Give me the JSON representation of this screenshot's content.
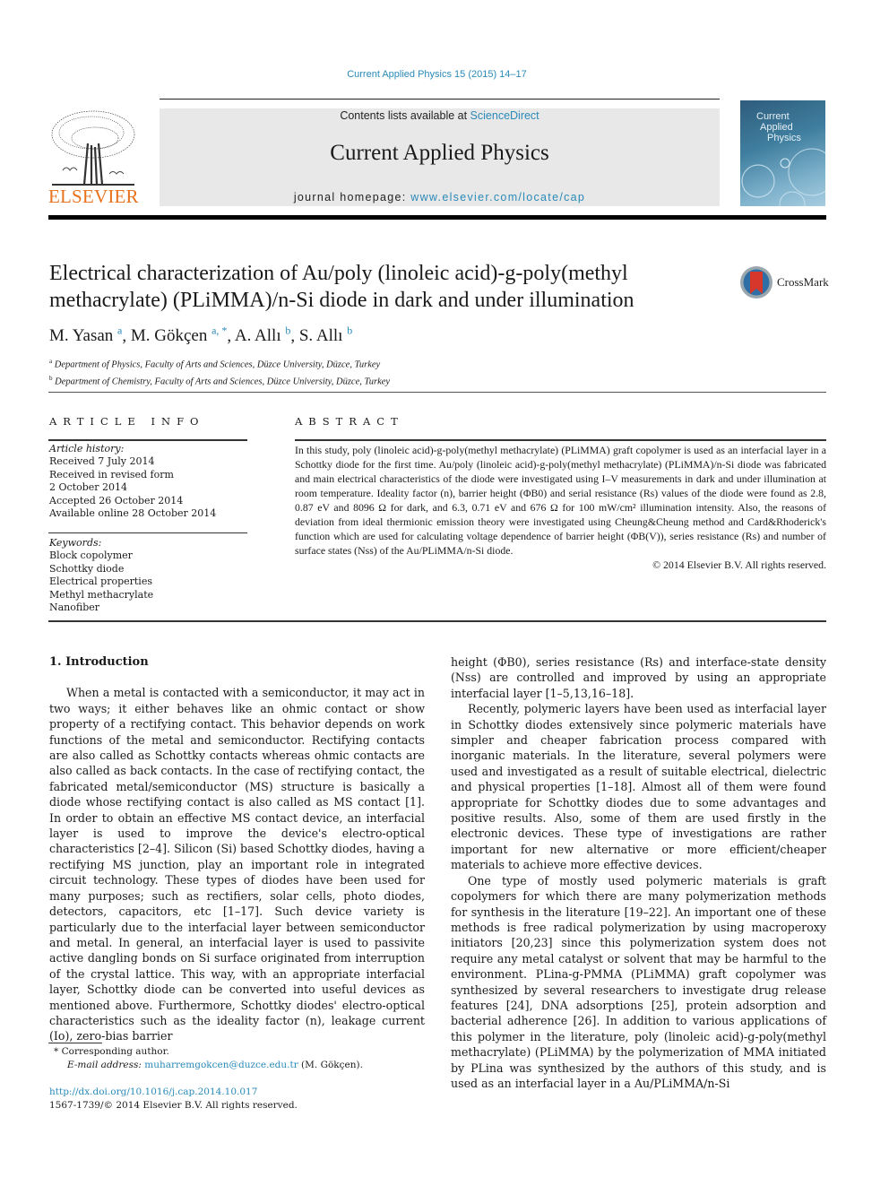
{
  "journal_reference": "Current Applied Physics 15 (2015) 14–17",
  "header": {
    "publisher_logo_text": "ELSEVIER",
    "contents_prefix": "Contents lists available at ",
    "contents_link": "ScienceDirect",
    "journal_name": "Current Applied Physics",
    "homepage_prefix": "journal homepage: ",
    "homepage_link": "www.elsevier.com/locate/cap",
    "cover_title_lines": [
      "Current",
      "Applied",
      "Physics"
    ]
  },
  "crossmark_label": "CrossMark",
  "article": {
    "title": "Electrical characterization of Au/poly (linoleic acid)-g-poly(methyl methacrylate) (PLiMMA)/n-Si diode in dark and under illumination",
    "authors": [
      {
        "name": "M. Yasan",
        "sup": "a"
      },
      {
        "name": "M. Gökçen",
        "sup": "a, *"
      },
      {
        "name": "A. Allı",
        "sup": "b"
      },
      {
        "name": "S. Allı",
        "sup": "b"
      }
    ],
    "affiliations": [
      {
        "mark": "a",
        "text": "Department of Physics, Faculty of Arts and Sciences, Düzce University, Düzce, Turkey"
      },
      {
        "mark": "b",
        "text": "Department of Chemistry, Faculty of Arts and Sciences, Düzce University, Düzce, Turkey"
      }
    ]
  },
  "article_info": {
    "heading": "ARTICLE INFO",
    "history_label": "Article history:",
    "history": [
      "Received 7 July 2014",
      "Received in revised form",
      "2 October 2014",
      "Accepted 26 October 2014",
      "Available online 28 October 2014"
    ],
    "keywords_label": "Keywords:",
    "keywords": [
      "Block copolymer",
      "Schottky diode",
      "Electrical properties",
      "Methyl methacrylate",
      "Nanofiber"
    ]
  },
  "abstract": {
    "heading": "ABSTRACT",
    "text": "In this study, poly (linoleic acid)-g-poly(methyl methacrylate) (PLiMMA) graft copolymer is used as an interfacial layer in a Schottky diode for the first time. Au/poly (linoleic acid)-g-poly(methyl methacrylate) (PLiMMA)/n-Si diode was fabricated and main electrical characteristics of the diode were investigated using I–V measurements in dark and under illumination at room temperature. Ideality factor (n), barrier height (ΦB0) and serial resistance (Rs) values of the diode were found as 2.8, 0.87 eV and 8096 Ω for dark, and 6.3, 0.71 eV and 676 Ω for 100 mW/cm² illumination intensity. Also, the reasons of deviation from ideal thermionic emission theory were investigated using Cheung&Cheung method and Card&Rhoderick's function which are used for calculating voltage dependence of barrier height (ΦB(V)), series resistance (Rs) and number of surface states (Nss) of the Au/PLiMMA/n-Si diode.",
    "copyright": "© 2014 Elsevier B.V. All rights reserved."
  },
  "body": {
    "section_heading": "1.  Introduction",
    "left_paragraphs": [
      "When a metal is contacted with a semiconductor, it may act in two ways; it either behaves like an ohmic contact or show property of a rectifying contact. This behavior depends on work functions of the metal and semiconductor. Rectifying contacts are also called as Schottky contacts whereas ohmic contacts are also called as back contacts. In the case of rectifying contact, the fabricated metal/semiconductor (MS) structure is basically a diode whose rectifying contact is also called as MS contact [1]. In order to obtain an effective MS contact device, an interfacial layer is used to improve the device's electro-optical characteristics [2–4]. Silicon (Si) based Schottky diodes, having a rectifying MS junction, play an important role in integrated circuit technology. These types of diodes have been used for many purposes; such as rectifiers, solar cells, photo diodes, detectors, capacitors, etc [1–17]. Such device variety is particularly due to the interfacial layer between semiconductor and metal. In general, an interfacial layer is used to passivite active dangling bonds on Si surface originated from interruption of the crystal lattice. This way, with an appropriate interfacial layer, Schottky diode can be converted into useful devices as mentioned above. Furthermore, Schottky diodes' electro-optical characteristics such as the ideality factor (n), leakage current (Io), zero-bias barrier"
    ],
    "right_paragraphs": [
      "height (ΦB0), series resistance (Rs) and interface-state density (Nss) are controlled and improved by using an appropriate interfacial layer [1–5,13,16–18].",
      "Recently, polymeric layers have been used as interfacial layer in Schottky diodes extensively since polymeric materials have simpler and cheaper fabrication process compared with inorganic materials. In the literature, several polymers were used and investigated as a result of suitable electrical, dielectric and physical properties [1–18]. Almost all of them were found appropriate for Schottky diodes due to some advantages and positive results. Also, some of them are used firstly in the electronic devices. These type of investigations are rather important for new alternative or more efficient/cheaper materials to achieve more effective devices.",
      "One type of mostly used polymeric materials is graft copolymers for which there are many polymerization methods for synthesis in the literature [19–22]. An important one of these methods is free radical polymerization by using macroperoxy initiators [20,23] since this polymerization system does not require any metal catalyst or solvent that may be harmful to the environment. PLina-g-PMMA (PLiMMA) graft copolymer was synthesized by several researchers to investigate drug release features [24], DNA adsorptions [25], protein adsorption and bacterial adherence [26]. In addition to various applications of this polymer in the literature, poly (linoleic acid)-g-poly(methyl methacrylate) (PLiMMA) by the polymerization of MMA initiated by PLina was synthesized by the authors of this study, and is used as an interfacial layer in a Au/PLiMMA/n-Si"
    ]
  },
  "footnotes": {
    "corresponding": "* Corresponding author.",
    "email_label": "E-mail address: ",
    "email": "muharremgokcen@duzce.edu.tr",
    "email_suffix": " (M. Gökçen).",
    "doi": "http://dx.doi.org/10.1016/j.cap.2014.10.017",
    "issn_line": "1567-1739/© 2014 Elsevier B.V. All rights reserved."
  },
  "colors": {
    "link": "#2a8ab8",
    "elsevier_orange": "#e9711c",
    "header_box": "#e8e8e8"
  }
}
